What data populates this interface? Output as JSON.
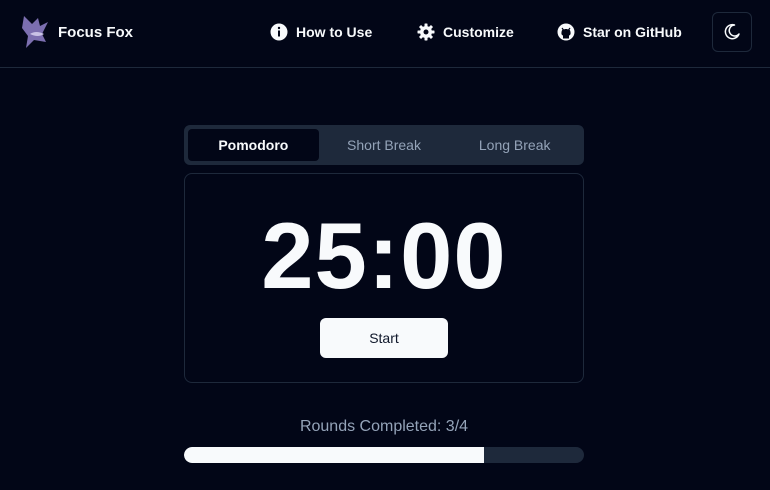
{
  "header": {
    "brand_name": "Focus Fox",
    "nav": [
      {
        "label": "How to Use",
        "icon": "info-icon"
      },
      {
        "label": "Customize",
        "icon": "gear-icon"
      },
      {
        "label": "Star on GitHub",
        "icon": "github-icon"
      }
    ],
    "theme_toggle_icon": "moon-icon"
  },
  "tabs": [
    {
      "label": "Pomodoro",
      "active": true
    },
    {
      "label": "Short Break",
      "active": false
    },
    {
      "label": "Long Break",
      "active": false
    }
  ],
  "timer": {
    "display": "25:00",
    "start_label": "Start"
  },
  "rounds": {
    "label": "Rounds Completed: 3/4",
    "completed": 3,
    "total": 4,
    "progress_fraction": 0.75
  },
  "colors": {
    "background": "#020617",
    "border": "#1e293b",
    "text": "#f8fafc",
    "muted": "#94a3b8",
    "logo": "#7c6fb0"
  }
}
